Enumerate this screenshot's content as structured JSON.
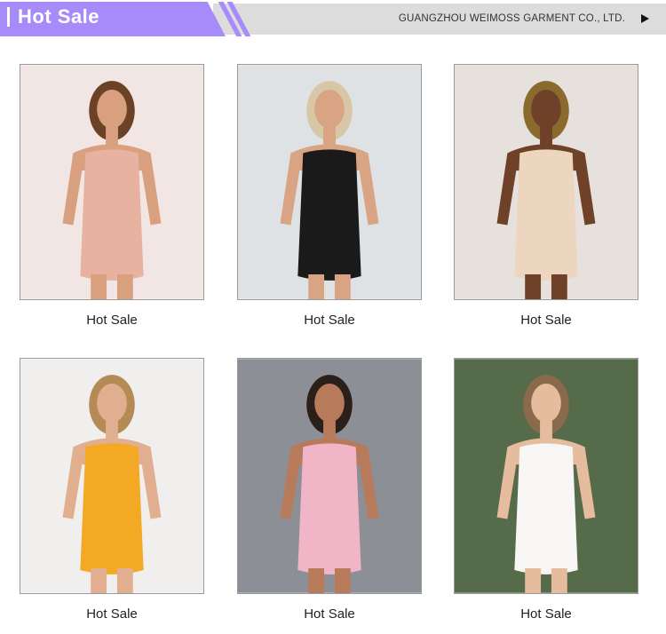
{
  "header": {
    "title": "Hot Sale",
    "company": "GUANGZHOU WEIMOSS GARMENT CO., LTD."
  },
  "products": [
    {
      "caption": "Hot Sale",
      "bg": "#f2e6e4",
      "dress": "#e7b29f",
      "skin": "#d9a080",
      "hair": "#6b4226"
    },
    {
      "caption": "Hot Sale",
      "bg": "#dfe2e4",
      "dress": "#1a1a1a",
      "skin": "#d8a483",
      "hair": "#d8c7a6"
    },
    {
      "caption": "Hot Sale",
      "bg": "#e6e1dc",
      "dress": "#ecd6bf",
      "skin": "#6e4128",
      "hair": "#8a6a2d"
    },
    {
      "caption": "Hot Sale",
      "bg": "#f1efee",
      "dress": "#f3a923",
      "skin": "#e1ae8f",
      "hair": "#b48a55"
    },
    {
      "caption": "Hot Sale",
      "bg": "#8d8f96",
      "dress": "#f1b5c8",
      "skin": "#b77b5c",
      "hair": "#2b1f1a"
    },
    {
      "caption": "Hot Sale",
      "bg": "#556b4a",
      "dress": "#f7f6f4",
      "skin": "#e6bc9f",
      "hair": "#8a6a4a"
    }
  ]
}
